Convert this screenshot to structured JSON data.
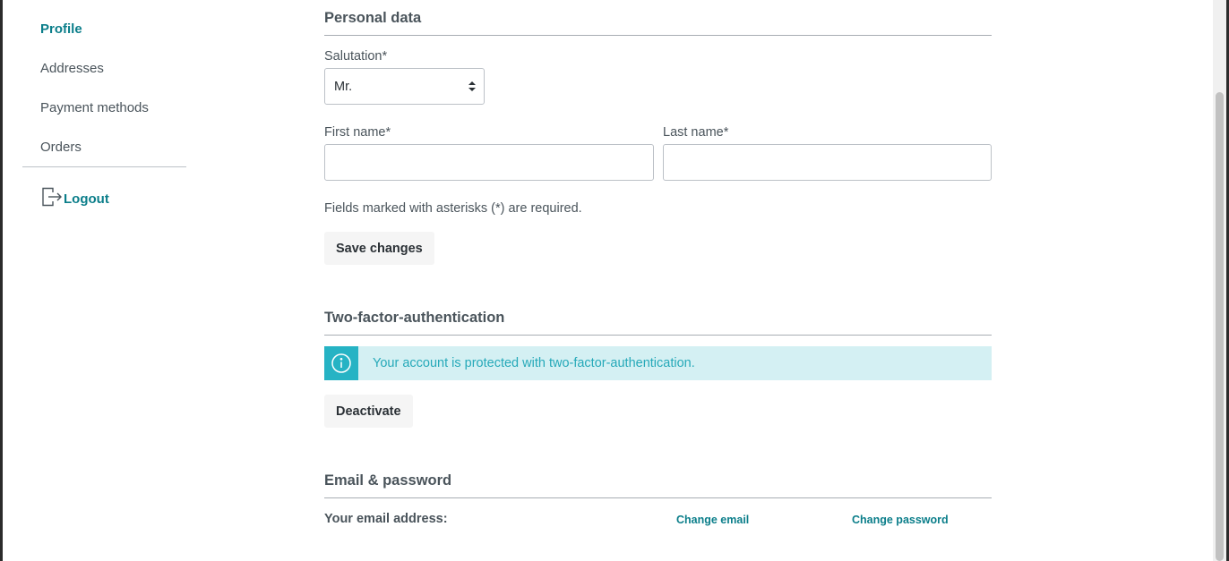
{
  "sidebar": {
    "items": [
      {
        "label": "Profile",
        "active": true
      },
      {
        "label": "Addresses"
      },
      {
        "label": "Payment methods"
      },
      {
        "label": "Orders"
      }
    ],
    "logout_label": "Logout"
  },
  "personal": {
    "title": "Personal data",
    "salutation_label": "Salutation*",
    "salutation_value": "Mr.",
    "first_name_label": "First name*",
    "first_name_value": "",
    "last_name_label": "Last name*",
    "last_name_value": "",
    "hint": "Fields marked with asterisks (*) are required.",
    "save_label": "Save changes"
  },
  "twofa": {
    "title": "Two-factor-authentication",
    "alert_text": "Your account is protected with two-factor-authentication.",
    "deactivate_label": "Deactivate"
  },
  "email_password": {
    "title": "Email & password",
    "email_label": "Your email address:",
    "change_email": "Change email",
    "change_password": "Change password"
  },
  "colors": {
    "accent": "#0b7e8a",
    "info": "#26b3c4",
    "info_bg": "#d4f0f3"
  }
}
